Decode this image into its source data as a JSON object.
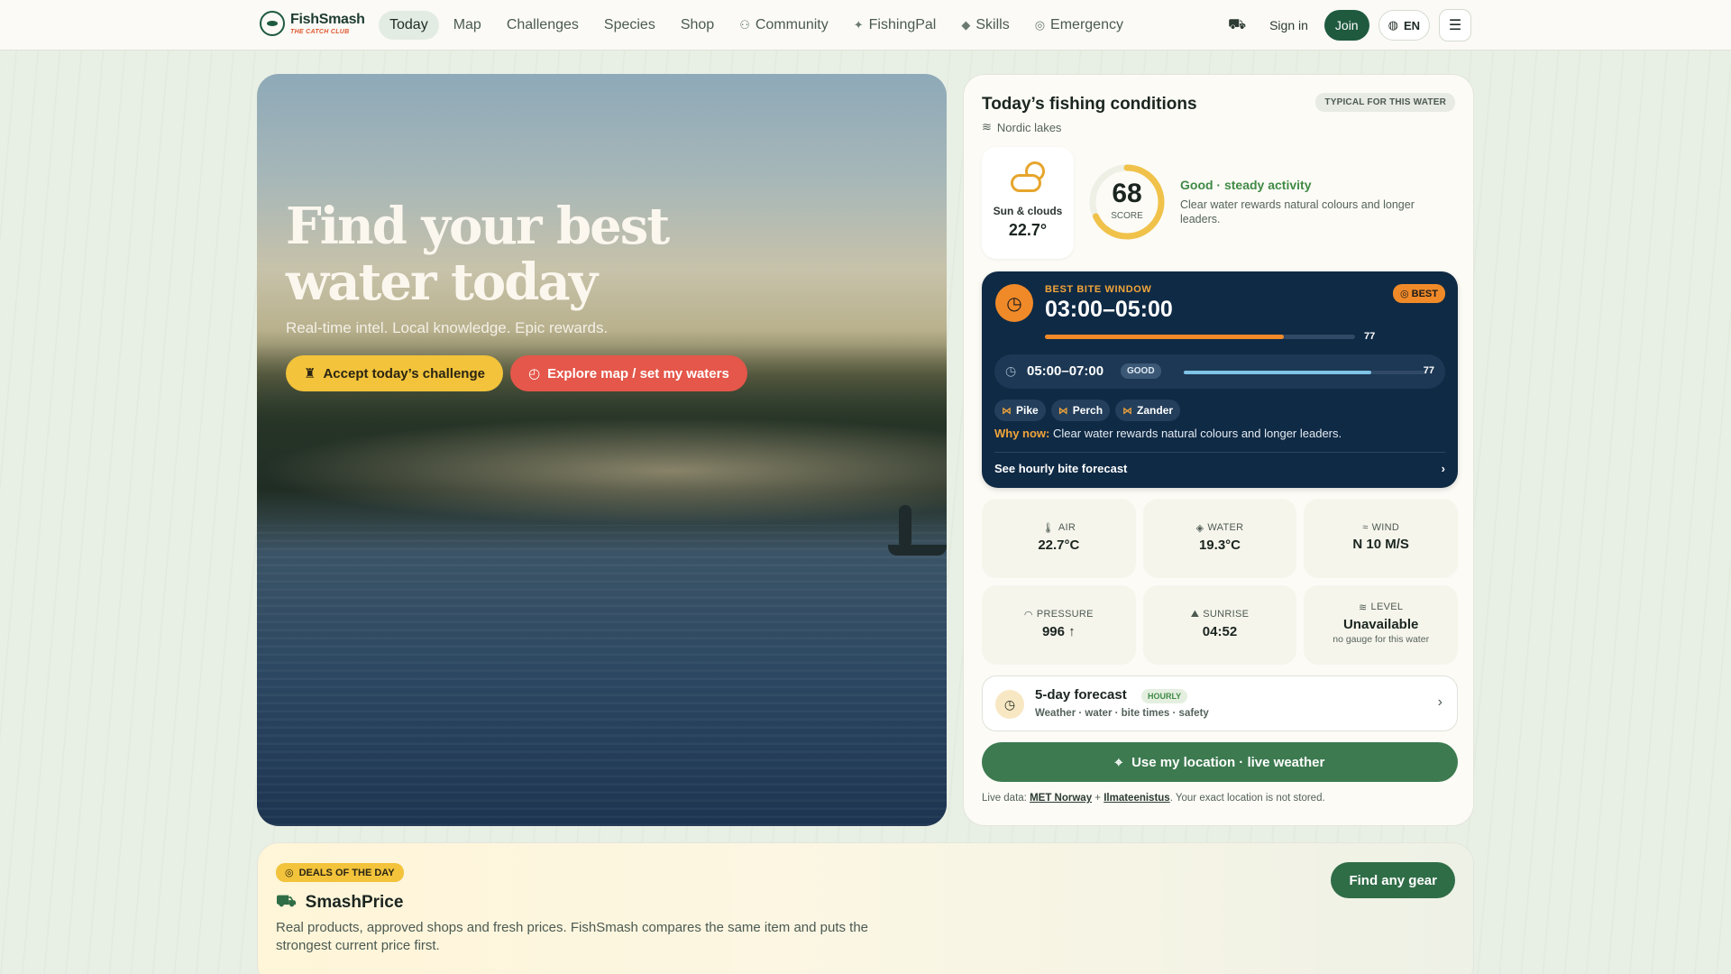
{
  "brand": {
    "name": "FishSmash",
    "tagline": "THE CATCH CLUB"
  },
  "nav": {
    "items": [
      {
        "label": "Today",
        "icon": ""
      },
      {
        "label": "Map",
        "icon": ""
      },
      {
        "label": "Challenges",
        "icon": ""
      },
      {
        "label": "Species",
        "icon": ""
      },
      {
        "label": "Shop",
        "icon": ""
      },
      {
        "label": "Community",
        "icon": "users-icon"
      },
      {
        "label": "FishingPal",
        "icon": "sparkle-icon"
      },
      {
        "label": "Skills",
        "icon": "graduation-cap-icon"
      },
      {
        "label": "Emergency",
        "icon": "lifebuoy-icon"
      }
    ],
    "active": "Today",
    "signin": "Sign in",
    "join": "Join",
    "language": "EN"
  },
  "hero": {
    "title": "Find your best water today",
    "subtitle": "Real-time intel. Local knowledge. Epic rewards.",
    "cta_primary": "Accept today’s challenge",
    "cta_secondary": "Explore map / set my waters"
  },
  "conditions": {
    "title": "Today’s fishing conditions",
    "region": "Nordic lakes",
    "badge": "TYPICAL FOR THIS WATER",
    "weather": {
      "label": "Sun & clouds",
      "temp": "22.7°"
    },
    "score": {
      "value": 68,
      "label": "SCORE",
      "headline": "Good · steady activity",
      "description": "Clear water rewards natural colours and longer leaders."
    },
    "bite": {
      "kicker": "BEST BITE WINDOW",
      "time": "03:00–05:00",
      "badge": "BEST",
      "score": 77,
      "secondary": {
        "time": "05:00–07:00",
        "rating": "GOOD",
        "score": 77
      },
      "species": [
        "Pike",
        "Perch",
        "Zander"
      ],
      "why_label": "Why now:",
      "why_text": "Clear water rewards natural colours and longer leaders.",
      "link": "See hourly bite forecast"
    },
    "metrics": [
      {
        "label": "AIR",
        "value": "22.7°C",
        "icon": "thermometer-icon"
      },
      {
        "label": "WATER",
        "value": "19.3°C",
        "icon": "droplet-icon"
      },
      {
        "label": "WIND",
        "value": "N 10 M/S",
        "icon": "wind-icon"
      },
      {
        "label": "PRESSURE",
        "value": "996 ↑",
        "icon": "gauge-icon"
      },
      {
        "label": "SUNRISE",
        "value": "04:52",
        "icon": "sunrise-icon"
      },
      {
        "label": "LEVEL",
        "value": "Unavailable",
        "note": "no gauge for this water",
        "icon": "waves-icon"
      }
    ],
    "forecast": {
      "title": "5-day forecast",
      "tag": "HOURLY",
      "subtitle": "Weather · water · bite times · safety"
    },
    "use_location": "Use my location · live weather",
    "live_data": {
      "prefix": "Live data: ",
      "source1": "MET Norway",
      "joiner": " + ",
      "source2": "Ilmateenistus",
      "suffix": ". Your exact location is not stored."
    }
  },
  "deals": {
    "badge": "DEALS OF THE DAY",
    "title": "SmashPrice",
    "description": "Real products, approved shops and fresh prices. FishSmash compares the same item and puts the strongest current price first.",
    "button": "Find any gear"
  },
  "colors": {
    "brand_green": "#1f5a3f",
    "accent_orange": "#f08a29",
    "accent_yellow": "#f2c33b",
    "accent_red": "#e4574a",
    "navy": "#0f2a45",
    "score_green": "#3f8a45"
  }
}
